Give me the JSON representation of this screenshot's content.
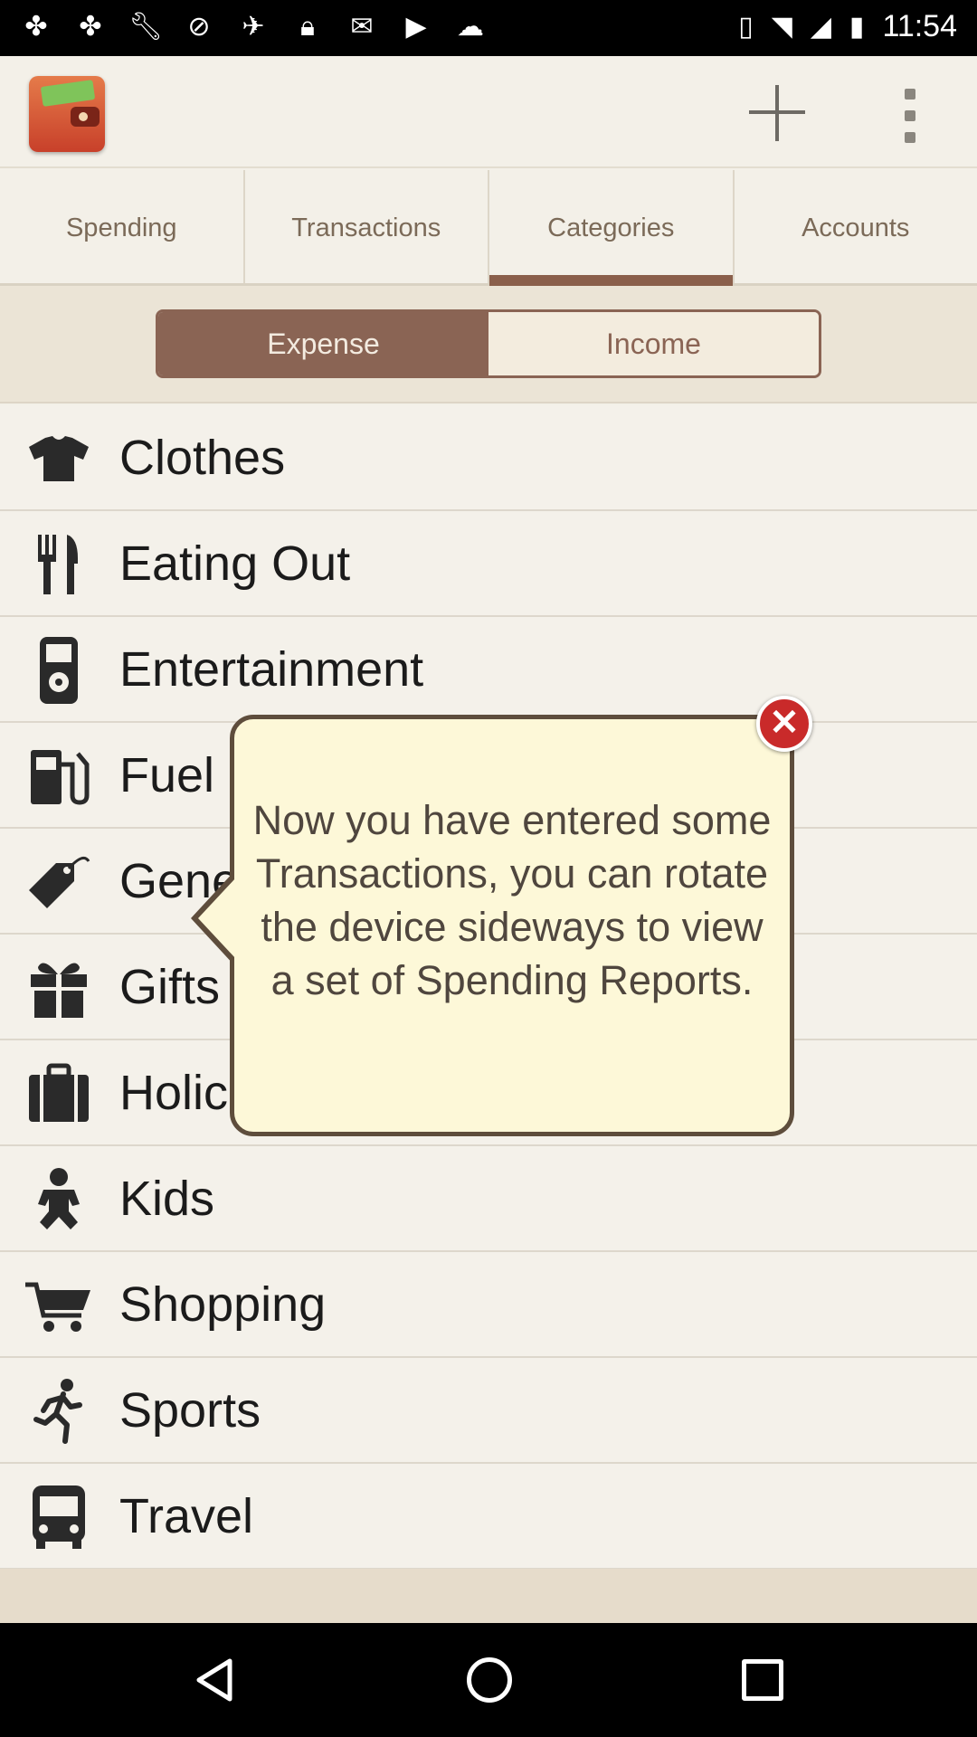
{
  "status_bar": {
    "time": "11:54",
    "left_icons": [
      "pinwheel-icon",
      "pinwheel-icon",
      "wrench-icon",
      "blocked-icon",
      "satellite-icon",
      "lock-icon",
      "mail-check-icon",
      "play-icon",
      "cloud-icon"
    ],
    "right_icons": [
      "vibrate-icon",
      "wifi-icon",
      "signal-icon",
      "battery-icon"
    ]
  },
  "app": {
    "logo_icon": "wallet-icon",
    "add_icon": "plus-icon",
    "menu_icon": "overflow-menu-icon"
  },
  "tabs": [
    {
      "label": "Spending",
      "active": false
    },
    {
      "label": "Transactions",
      "active": false
    },
    {
      "label": "Categories",
      "active": true
    },
    {
      "label": "Accounts",
      "active": false
    }
  ],
  "segment": {
    "expense": "Expense",
    "income": "Income",
    "selected": "Expense"
  },
  "categories": [
    {
      "label": "Clothes",
      "icon": "tshirt-icon"
    },
    {
      "label": "Eating Out",
      "icon": "fork-knife-icon"
    },
    {
      "label": "Entertainment",
      "icon": "music-player-icon"
    },
    {
      "label": "Fuel",
      "icon": "fuel-pump-icon"
    },
    {
      "label": "Gene",
      "icon": "price-tag-icon"
    },
    {
      "label": "Gifts",
      "icon": "gift-icon"
    },
    {
      "label": "Holic",
      "icon": "suitcase-icon"
    },
    {
      "label": "Kids",
      "icon": "baby-icon"
    },
    {
      "label": "Shopping",
      "icon": "cart-icon"
    },
    {
      "label": "Sports",
      "icon": "runner-icon"
    },
    {
      "label": "Travel",
      "icon": "bus-icon"
    }
  ],
  "tooltip": {
    "text": "Now you have entered some Transactions, you can rotate the device sideways to view a set of Spending Reports.",
    "close_icon": "close-icon",
    "close_glyph": "✕"
  },
  "nav": {
    "back_icon": "back-icon",
    "home_icon": "home-icon",
    "recent_icon": "recent-apps-icon"
  }
}
